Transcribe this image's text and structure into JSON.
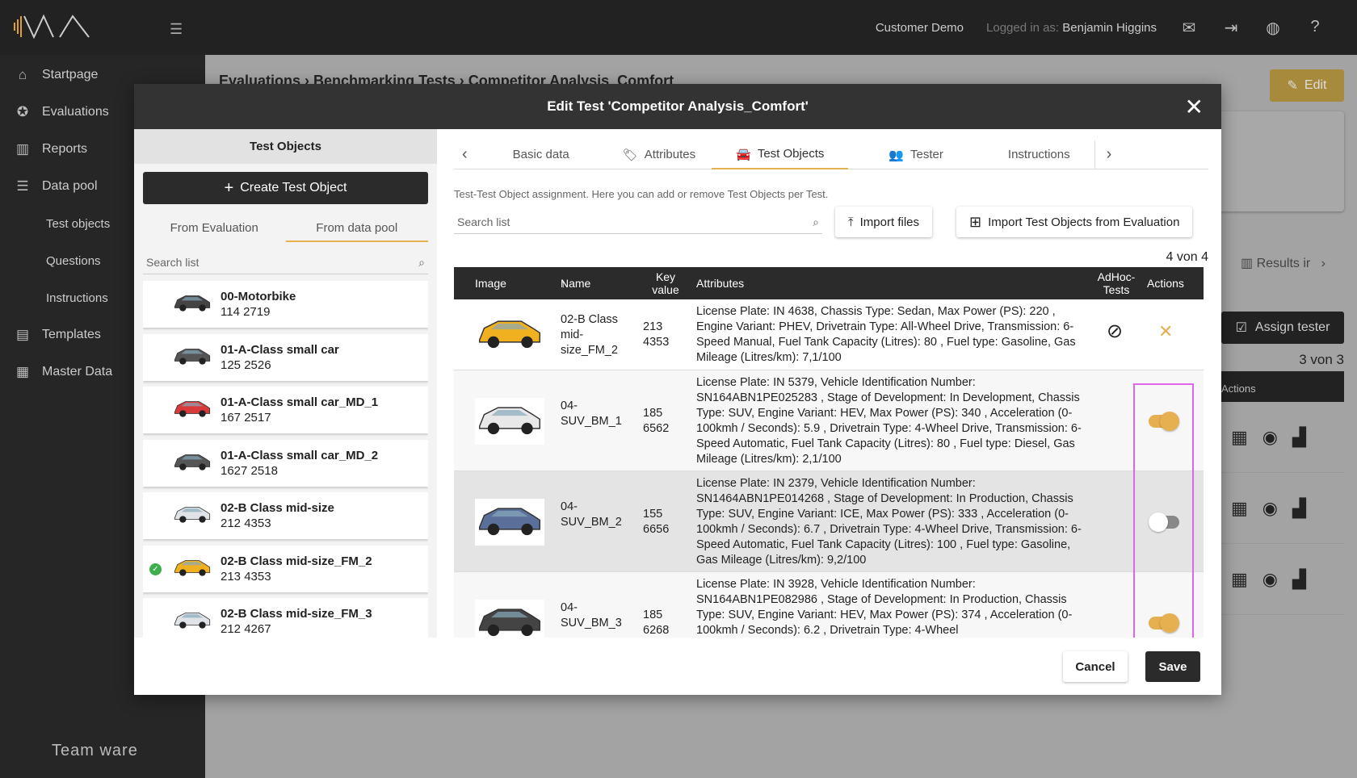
{
  "topbar": {
    "customer": "Customer Demo",
    "logged_in_label": "Logged in as:",
    "user": "Benjamin Higgins"
  },
  "sidebar": {
    "items": [
      {
        "label": "Startpage",
        "icon": "home-icon"
      },
      {
        "label": "Evaluations",
        "icon": "star-icon"
      },
      {
        "label": "Reports",
        "icon": "chart-icon"
      },
      {
        "label": "Data pool",
        "icon": "database-icon"
      }
    ],
    "sub": [
      "Test objects",
      "Questions",
      "Instructions"
    ],
    "items2": [
      {
        "label": "Templates",
        "icon": "template-icon"
      },
      {
        "label": "Master Data",
        "icon": "master-data-icon"
      }
    ],
    "footer_logo": "Team ware"
  },
  "background": {
    "breadcrumb": [
      "Evaluations",
      "Benchmarking Tests",
      "Competitor Analysis_Comfort"
    ],
    "edit": "Edit",
    "results": "Results ir",
    "assign": "Assign tester",
    "count": "3 von 3",
    "actions": "Actions"
  },
  "modal": {
    "title": "Edit Test 'Competitor Analysis_Comfort'",
    "left": {
      "title": "Test Objects",
      "create": "Create Test Object",
      "tabs": [
        "From Evaluation",
        "From data pool"
      ],
      "active_tab": 1,
      "search_placeholder": "Search list",
      "items": [
        {
          "name": "00-Motorbike",
          "key": "114 2719",
          "color": "#444444",
          "checked": false
        },
        {
          "name": "01-A-Class small car",
          "key": "125 2526",
          "color": "#555555",
          "checked": false
        },
        {
          "name": "01-A-Class small car_MD_1",
          "key": "167 2517",
          "color": "#d83a3a",
          "checked": false
        },
        {
          "name": "01-A-Class small car_MD_2",
          "key": "1627 2518",
          "color": "#555555",
          "checked": false
        },
        {
          "name": "02-B Class mid-size",
          "key": "212 4353",
          "color": "#dfe3e8",
          "checked": false
        },
        {
          "name": "02-B Class mid-size_FM_2",
          "key": "213 4353",
          "color": "#f0b020",
          "checked": true
        },
        {
          "name": "02-B Class mid-size_FM_3",
          "key": "212 4267",
          "color": "#dfe3e8",
          "checked": false
        }
      ]
    },
    "tabs": [
      "Basic data",
      "Attributes",
      "Test Objects",
      "Tester",
      "Instructions"
    ],
    "active_tab": 2,
    "description": "Test-Test Object assignment. Here you can add or remove Test Objects per Test.",
    "search_placeholder": "Search list",
    "import_files": "Import files",
    "import_eval": "Import Test Objects from Evaluation",
    "count": "4 von 4",
    "columns": [
      "Image",
      "Name",
      "Key value",
      "Attributes",
      "AdHoc-Tests",
      "Actions"
    ],
    "rows": [
      {
        "name": "02-B Class mid-size_FM_2",
        "key": "213 4353",
        "color": "#f0b020",
        "attributes": "License Plate: IN 4638, Chassis Type: Sedan, Max Power (PS): 220 , Engine Variant: PHEV, Drivetrain Type: All-Wheel Drive, Transmission: 6-Speed Manual, Fuel Tank Capacity (Litres): 80 , Fuel type: Gasoline, Gas Mileage (Litres/km): 7,1/100",
        "adhoc": "disabled",
        "toggle": null
      },
      {
        "name": "04-SUV_BM_1",
        "key": "185 6562",
        "color": "#e8e8e8",
        "attributes": "License Plate: IN 5379, Vehicle Identification Number: SN164ABN1PE025283 , Stage of Development: In Development, Chassis Type: SUV, Engine Variant: HEV, Max Power (PS): 340 , Acceleration (0-100kmh / Seconds): 5.9 , Drivetrain Type: 4-Wheel Drive, Transmission: 6-Speed Automatic, Fuel Tank Capacity (Litres): 80 , Fuel type: Diesel, Gas Mileage (Litres/km): 2,1/100",
        "toggle": true
      },
      {
        "name": "04-SUV_BM_2",
        "key": "155 6656",
        "color": "#5a6f9a",
        "attributes": "License Plate: IN 2379, Vehicle Identification Number: SN1464ABN1PE014268 , Stage of Development: In Production, Chassis Type: SUV, Engine Variant: ICE, Max Power (PS): 333 , Acceleration (0-100kmh / Seconds): 6.7 , Drivetrain Type: 4-Wheel Drive, Transmission: 6-Speed Automatic, Fuel Tank Capacity (Litres): 100 , Fuel type: Gasoline, Gas Mileage (Litres/km): 9,2/100",
        "toggle": false
      },
      {
        "name": "04-SUV_BM_3",
        "key": "185 6268",
        "color": "#444444",
        "attributes": "License Plate: IN 3928, Vehicle Identification Number: SN164ABN1PE082986 , Stage of Development: In Production, Chassis Type: SUV, Engine Variant: HEV, Max Power (PS): 374 , Acceleration (0-100kmh / Seconds): 6.2 , Drivetrain Type: 4-Wheel",
        "toggle": true
      }
    ],
    "cancel": "Cancel",
    "save": "Save"
  },
  "colors": {
    "accent": "#e6b050",
    "dark": "#2b2b2b",
    "highlight": "#e066e8",
    "check": "#3cae4d"
  }
}
